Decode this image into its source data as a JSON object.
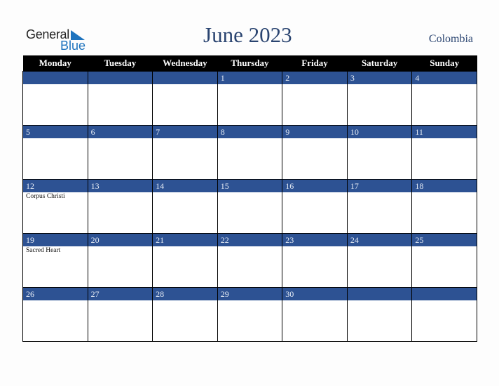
{
  "logo": {
    "general": "General",
    "blue": "Blue",
    "icon": "triangle-flag-icon"
  },
  "title": "June 2023",
  "country": "Colombia",
  "colors": {
    "header_bg": "#000000",
    "band_bg": "#2d5293",
    "title": "#2a4470",
    "logo_blue": "#1e73be"
  },
  "weekdays": [
    "Monday",
    "Tuesday",
    "Wednesday",
    "Thursday",
    "Friday",
    "Saturday",
    "Sunday"
  ],
  "weeks": [
    [
      {
        "day": "",
        "event": ""
      },
      {
        "day": "",
        "event": ""
      },
      {
        "day": "",
        "event": ""
      },
      {
        "day": "1",
        "event": ""
      },
      {
        "day": "2",
        "event": ""
      },
      {
        "day": "3",
        "event": ""
      },
      {
        "day": "4",
        "event": ""
      }
    ],
    [
      {
        "day": "5",
        "event": ""
      },
      {
        "day": "6",
        "event": ""
      },
      {
        "day": "7",
        "event": ""
      },
      {
        "day": "8",
        "event": ""
      },
      {
        "day": "9",
        "event": ""
      },
      {
        "day": "10",
        "event": ""
      },
      {
        "day": "11",
        "event": ""
      }
    ],
    [
      {
        "day": "12",
        "event": "Corpus Christi"
      },
      {
        "day": "13",
        "event": ""
      },
      {
        "day": "14",
        "event": ""
      },
      {
        "day": "15",
        "event": ""
      },
      {
        "day": "16",
        "event": ""
      },
      {
        "day": "17",
        "event": ""
      },
      {
        "day": "18",
        "event": ""
      }
    ],
    [
      {
        "day": "19",
        "event": "Sacred Heart"
      },
      {
        "day": "20",
        "event": ""
      },
      {
        "day": "21",
        "event": ""
      },
      {
        "day": "22",
        "event": ""
      },
      {
        "day": "23",
        "event": ""
      },
      {
        "day": "24",
        "event": ""
      },
      {
        "day": "25",
        "event": ""
      }
    ],
    [
      {
        "day": "26",
        "event": ""
      },
      {
        "day": "27",
        "event": ""
      },
      {
        "day": "28",
        "event": ""
      },
      {
        "day": "29",
        "event": ""
      },
      {
        "day": "30",
        "event": ""
      },
      {
        "day": "",
        "event": ""
      },
      {
        "day": "",
        "event": ""
      }
    ]
  ]
}
